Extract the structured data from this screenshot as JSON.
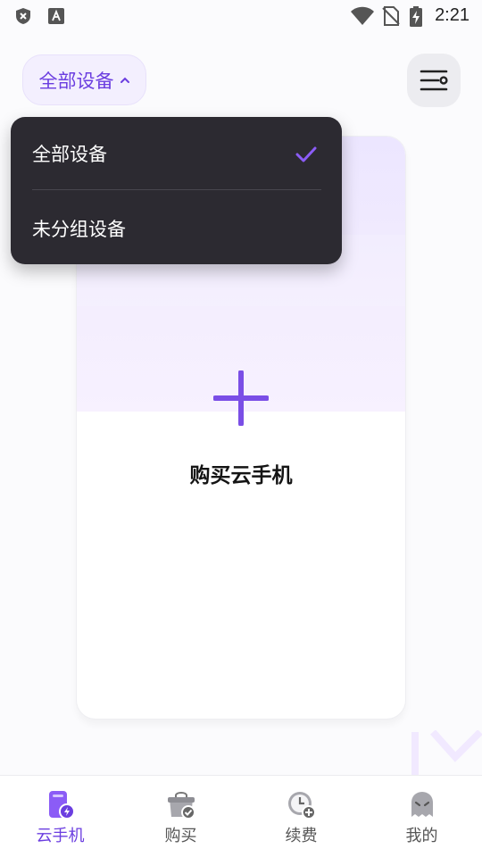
{
  "status_bar": {
    "time": "2:21",
    "icons": [
      "shield-x-icon",
      "font-a-icon",
      "wifi-icon",
      "no-sim-icon",
      "battery-charging-icon"
    ]
  },
  "header": {
    "group_selector_label": "全部设备",
    "group_selector_icon": "chevron-up-icon",
    "menu_icon": "menu-settings-icon"
  },
  "dropdown": {
    "items": [
      {
        "label": "全部设备",
        "selected": true
      },
      {
        "label": "未分组设备",
        "selected": false
      }
    ],
    "check_icon": "checkmark-icon"
  },
  "card": {
    "action_label": "购买云手机",
    "icon": "plus-icon"
  },
  "bottom_nav": {
    "items": [
      {
        "label": "云手机",
        "icon": "cloud-phone-icon",
        "active": true
      },
      {
        "label": "购买",
        "icon": "shopping-bag-icon",
        "active": false
      },
      {
        "label": "续费",
        "icon": "clock-plus-icon",
        "active": false
      },
      {
        "label": "我的",
        "icon": "ghost-icon",
        "active": false
      }
    ]
  },
  "colors": {
    "accent": "#6b3ee0",
    "dropdown_bg": "#2c2a31",
    "card_gradient_top": "#ece6ff"
  }
}
